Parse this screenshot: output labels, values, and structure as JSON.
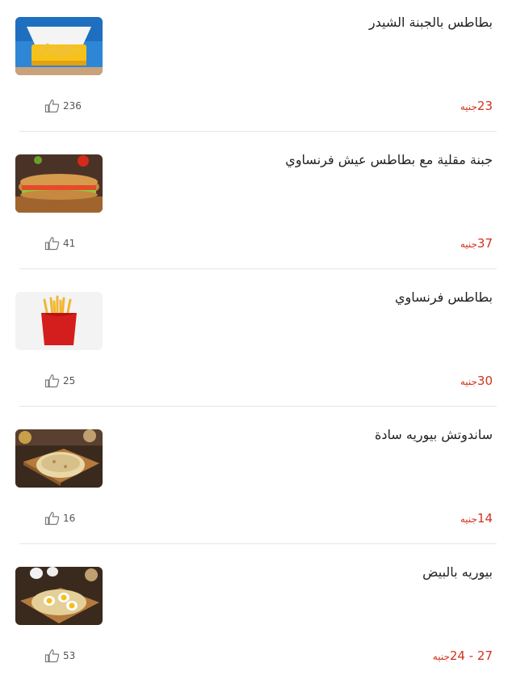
{
  "items": [
    {
      "name": "بطاطس بالجبنة الشيدر",
      "price": "23",
      "currency": "جنيه",
      "likes": "236",
      "image": "cheddar-fries-box"
    },
    {
      "name": "جبنة مقلية مع بطاطس عيش فرنساوي",
      "price": "37",
      "currency": "جنيه",
      "likes": "41",
      "image": "fried-cheese-baguette"
    },
    {
      "name": "بطاطس فرنساوي",
      "price": "30",
      "currency": "جنيه",
      "likes": "25",
      "image": "french-fries-red-box"
    },
    {
      "name": "ساندوتش بيوريه سادة",
      "price": "14",
      "currency": "جنيه",
      "likes": "16",
      "image": "plain-puree-pita"
    },
    {
      "name": "بيوريه بالبيض",
      "price": "24 - 27",
      "currency": "جنيه",
      "likes": "53",
      "image": "puree-egg-pita"
    }
  ],
  "icons": {
    "like": "thumbs-up-icon"
  },
  "colors": {
    "price": "#d2321e",
    "divider": "#e6e6e6",
    "text": "#222222",
    "likes": "#555555"
  }
}
